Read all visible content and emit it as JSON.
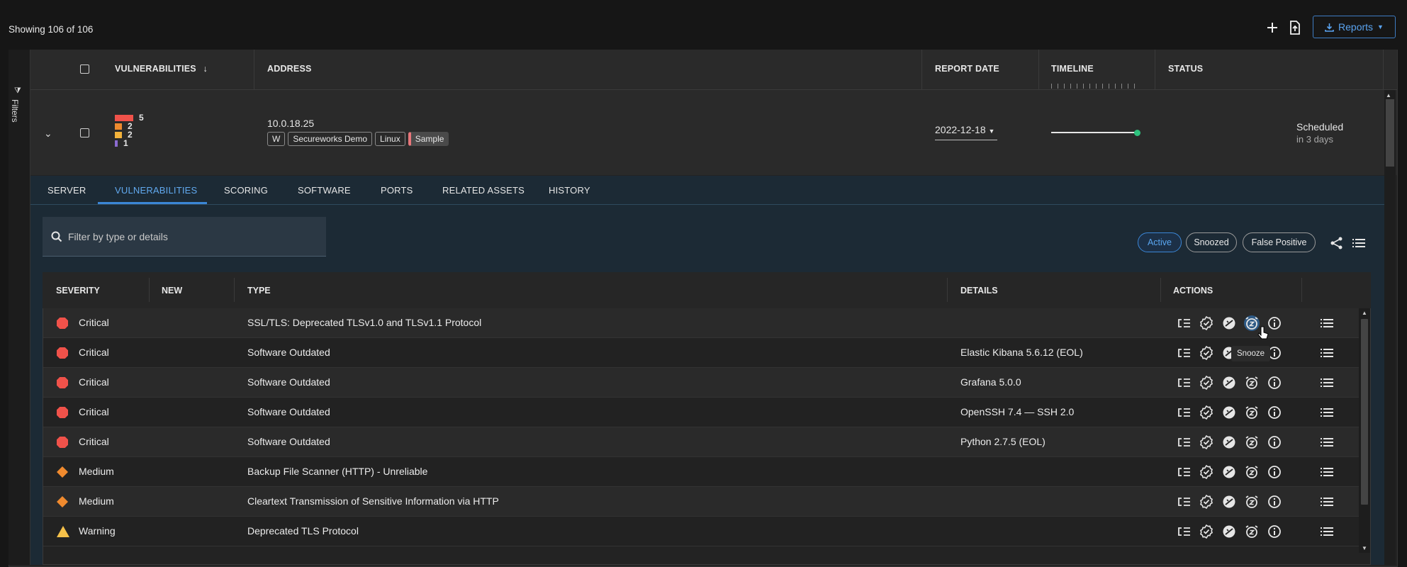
{
  "toolbar": {
    "showing": "Showing 106 of 106",
    "add_icon": "plus-icon",
    "upload_icon": "upload-file-icon",
    "reports_label": "Reports",
    "reports_icon": "download-icon"
  },
  "filters": {
    "label": "Filters",
    "icon": "filter-icon"
  },
  "table": {
    "headers": {
      "vulnerabilities": "VULNERABILITIES",
      "address": "ADDRESS",
      "report_date": "REPORT DATE",
      "timeline": "TIMELINE",
      "status": "STATUS"
    },
    "asset": {
      "severity_counts": [
        "5",
        "2",
        "2",
        "1"
      ],
      "severity_colors": [
        "#f0524a",
        "#ee8a2e",
        "#f2b23b",
        "#8b6bd1"
      ],
      "ip": "10.0.18.25",
      "tags": [
        "W",
        "Secureworks Demo",
        "Linux",
        "Sample"
      ],
      "report_date": "2022-12-18",
      "status": "Scheduled",
      "status_sub": "in 3 days"
    }
  },
  "tabs": [
    "SERVER",
    "VULNERABILITIES",
    "SCORING",
    "SOFTWARE",
    "PORTS",
    "RELATED ASSETS",
    "HISTORY"
  ],
  "active_tab": "VULNERABILITIES",
  "search": {
    "placeholder": "Filter by type or details"
  },
  "filter_pills": [
    "Active",
    "Snoozed",
    "False Positive"
  ],
  "active_pill": "Active",
  "vuln_headers": {
    "severity": "SEVERITY",
    "new": "NEW",
    "type": "TYPE",
    "details": "DETAILS",
    "actions": "ACTIONS"
  },
  "vulns": [
    {
      "severity": "Critical",
      "type": "SSL/TLS: Deprecated TLSv1.0 and TLSv1.1 Protocol",
      "details": ""
    },
    {
      "severity": "Critical",
      "type": "Software Outdated",
      "details": "Elastic Kibana 5.6.12 (EOL)"
    },
    {
      "severity": "Critical",
      "type": "Software Outdated",
      "details": "Grafana 5.0.0"
    },
    {
      "severity": "Critical",
      "type": "Software Outdated",
      "details": "OpenSSH 7.4 — SSH 2.0"
    },
    {
      "severity": "Critical",
      "type": "Software Outdated",
      "details": "Python 2.7.5 (EOL)"
    },
    {
      "severity": "Medium",
      "type": "Backup File Scanner (HTTP) - Unreliable",
      "details": ""
    },
    {
      "severity": "Medium",
      "type": "Cleartext Transmission of Sensitive Information via HTTP",
      "details": ""
    },
    {
      "severity": "Warning",
      "type": "Deprecated TLS Protocol",
      "details": ""
    }
  ],
  "severity_colors": {
    "Critical": "#f0524a",
    "Medium": "#f08a2e",
    "Warning": "#f5c14a"
  },
  "action_icons": [
    "compare-icon",
    "approve-icon",
    "false-positive-icon",
    "snooze-icon",
    "info-icon",
    "list-icon"
  ],
  "tooltip": "Snooze"
}
